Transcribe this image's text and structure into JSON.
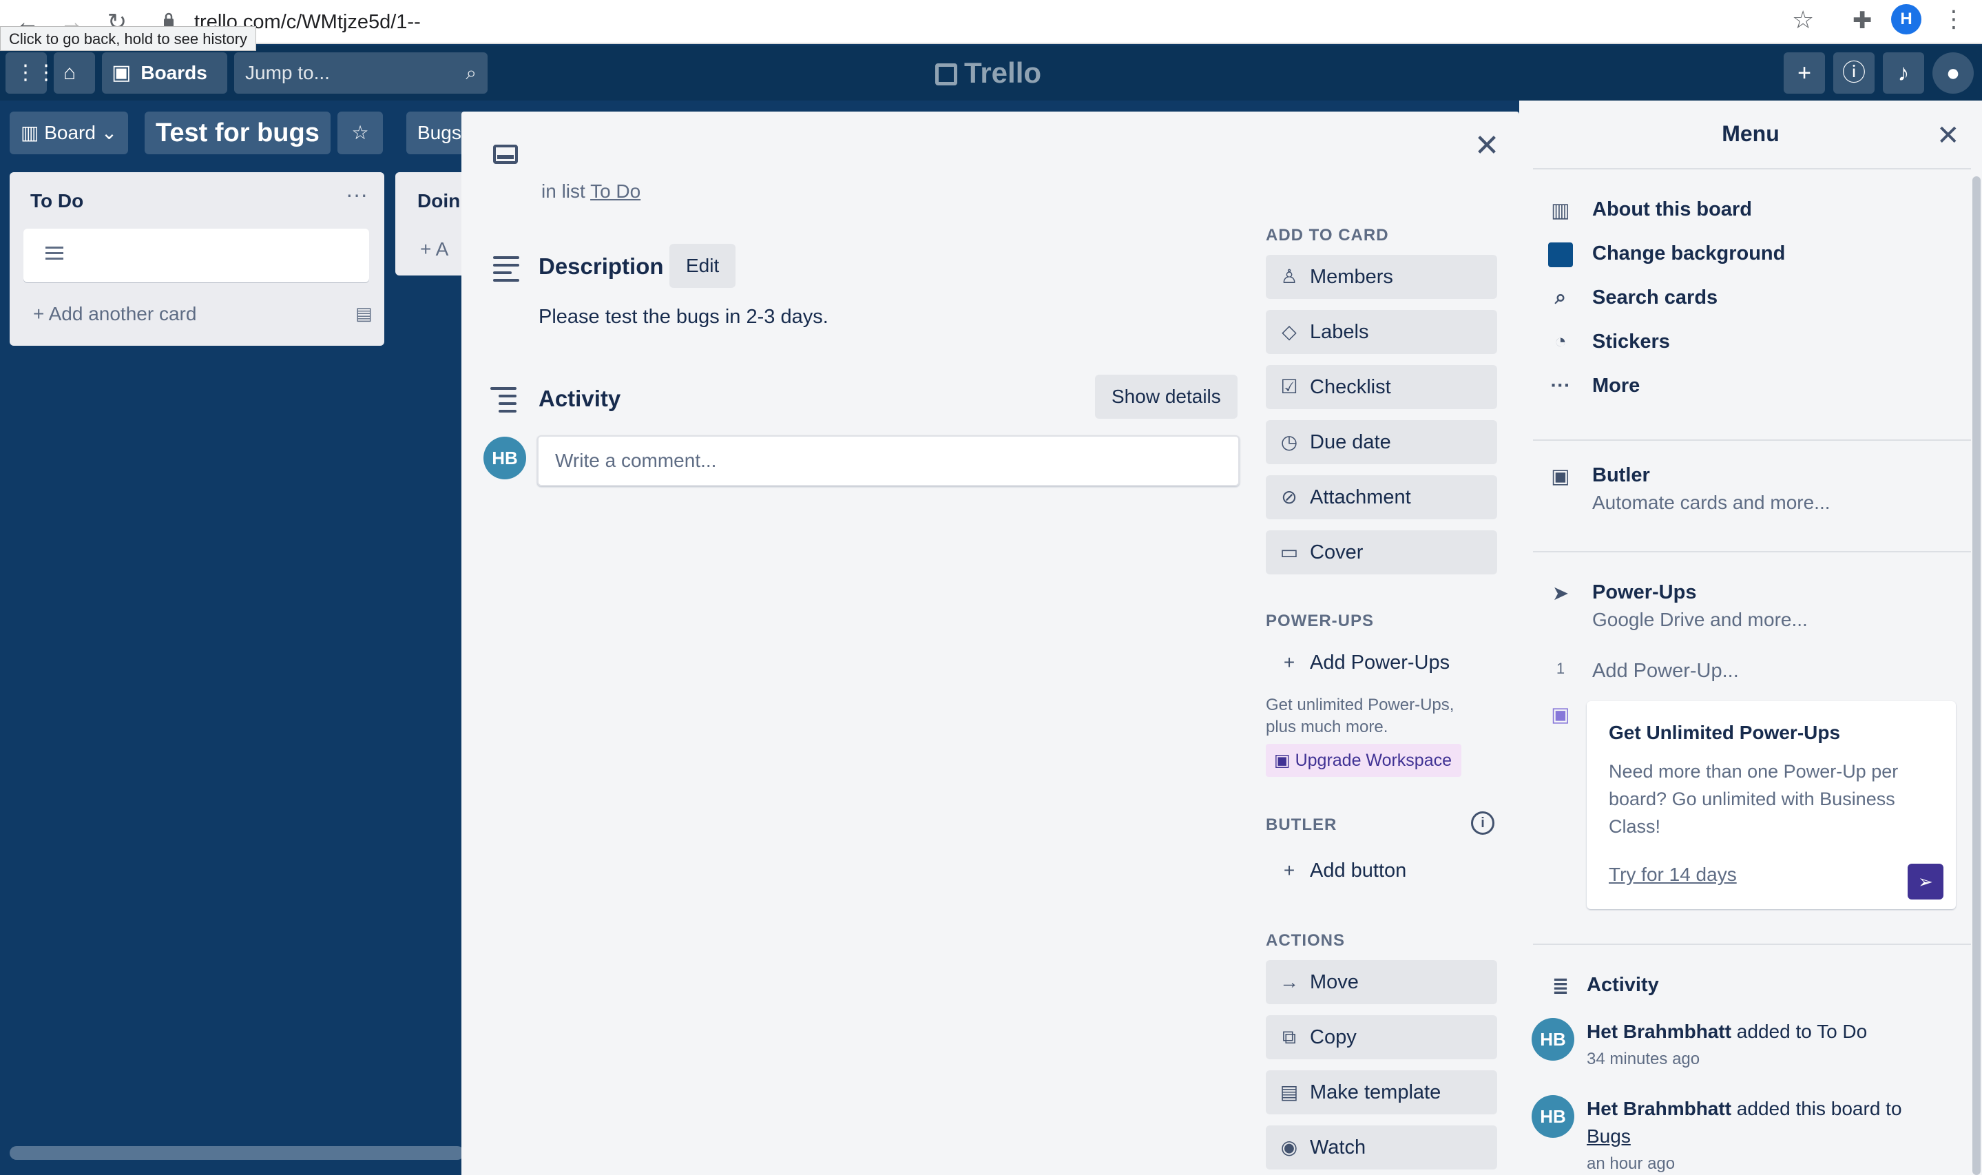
{
  "browser": {
    "url": "trello.com/c/WMtjze5d/1--",
    "tooltip": "Click to go back, hold to see history",
    "profile_initial": "H"
  },
  "header": {
    "boards_label": "Boards",
    "search_placeholder": "Jump to...",
    "logo": "Trello"
  },
  "board": {
    "view_label": "Board",
    "title": "Test for bugs",
    "workspace_chip": "Bugs"
  },
  "lists": [
    {
      "title": "To Do",
      "add_card": "Add another card"
    },
    {
      "title": "Doing",
      "add_card": "Add a card"
    }
  ],
  "card_modal": {
    "in_list_prefix": "in list",
    "list_name": "To Do",
    "description_title": "Description",
    "edit_label": "Edit",
    "description_text": "Please test the bugs in 2-3 days.",
    "activity_title": "Activity",
    "show_details_label": "Show details",
    "avatar_initials": "HB",
    "comment_placeholder": "Write a comment...",
    "add_to_card_heading": "ADD TO CARD",
    "add_to_card": [
      "Members",
      "Labels",
      "Checklist",
      "Due date",
      "Attachment",
      "Cover"
    ],
    "powerups_heading": "POWER-UPS",
    "add_powerups": "Add Power-Ups",
    "upsell_line1": "Get unlimited Power-Ups,",
    "upsell_line2": "plus much more.",
    "upgrade_label": "Upgrade Workspace",
    "butler_heading": "BUTLER",
    "add_button": "Add button",
    "actions_heading": "ACTIONS",
    "actions": [
      "Move",
      "Copy",
      "Make template",
      "Watch"
    ]
  },
  "menu": {
    "title": "Menu",
    "items": [
      "About this board",
      "Change background",
      "Search cards",
      "Stickers",
      "More"
    ],
    "butler_title": "Butler",
    "butler_sub": "Automate cards and more...",
    "powerups_title": "Power-Ups",
    "powerups_sub": "Google Drive and more...",
    "powerup_count": "1",
    "add_powerup": "Add Power-Up...",
    "promo_title": "Get Unlimited Power-Ups",
    "promo_text": "Need more than one Power-Up per board? Go unlimited with Business Class!",
    "promo_link": "Try for 14 days",
    "activity_title": "Activity",
    "activity": [
      {
        "user": "Het Brahmbhatt",
        "action": "added to To Do",
        "target": "",
        "time": "34 minutes ago"
      },
      {
        "user": "Het Brahmbhatt",
        "action": "added this board to",
        "target": "Bugs",
        "time": "an hour ago"
      }
    ]
  }
}
